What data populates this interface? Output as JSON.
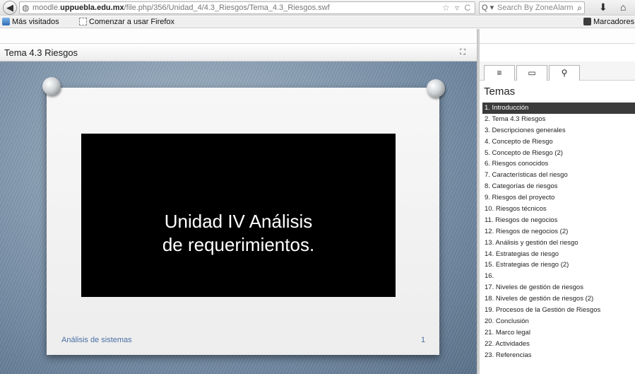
{
  "browser": {
    "url_prefix": "moodle.",
    "url_domain": "uppuebla.edu.mx",
    "url_path": "/file.php/356/Unidad_4/4.3_Riesgos/Tema_4.3_Riesgos.swf",
    "search_placeholder": "Search By ZoneAlarm",
    "back_glyph": "◀",
    "globe_glyph": "◍",
    "url_icons": "☆ ▿ C",
    "search_engine_glyph": "Q ▾",
    "search_glyph": "⌕",
    "download_glyph": "⬇",
    "home_glyph": "⌂"
  },
  "bookmarks": {
    "most_visited": "Más visitados",
    "getting_started": "Comenzar a usar Firefox",
    "bookmarks_menu": "Marcadores"
  },
  "presentation": {
    "title": "Tema 4.3 Riesgos",
    "fullscreen_glyph": "⛶",
    "slide_title_line1": "Unidad IV  Análisis",
    "slide_title_line2": "de requerimientos.",
    "slide_footer": "Análisis de sistemas",
    "slide_number": "1"
  },
  "sidebar": {
    "tab_outline_glyph": "≡",
    "tab_thumbnails_glyph": "▭",
    "tab_search_glyph": "⚲",
    "heading": "Temas",
    "items": [
      "1.  Introducción",
      "2.  Tema 4.3 Riesgos",
      "3.  Descripciones generales",
      "4.  Concepto de Riesgo",
      "5.  Concepto de Riesgo (2)",
      "6.  Riesgos conocidos",
      "7.  Características del riesgo",
      "8.  Categorías de riesgos",
      "9.  Riesgos del proyecto",
      "10. Riesgos técnicos",
      "11. Riesgos de negocios",
      "12. Riesgos de negocios (2)",
      "13. Análisis y gestión del riesgo",
      "14. Estrategias de riesgo",
      "15. Estrategias de riesgo (2)",
      "16.",
      "17. Niveles de gestión de riesgos",
      "18. Niveles de gestión de riesgos (2)",
      "19. Procesos de la Gestión de Riesgos",
      "20. Conclusión",
      "21. Marco legal",
      "22. Actividades",
      "23. Referencias"
    ],
    "active_index": 0
  }
}
